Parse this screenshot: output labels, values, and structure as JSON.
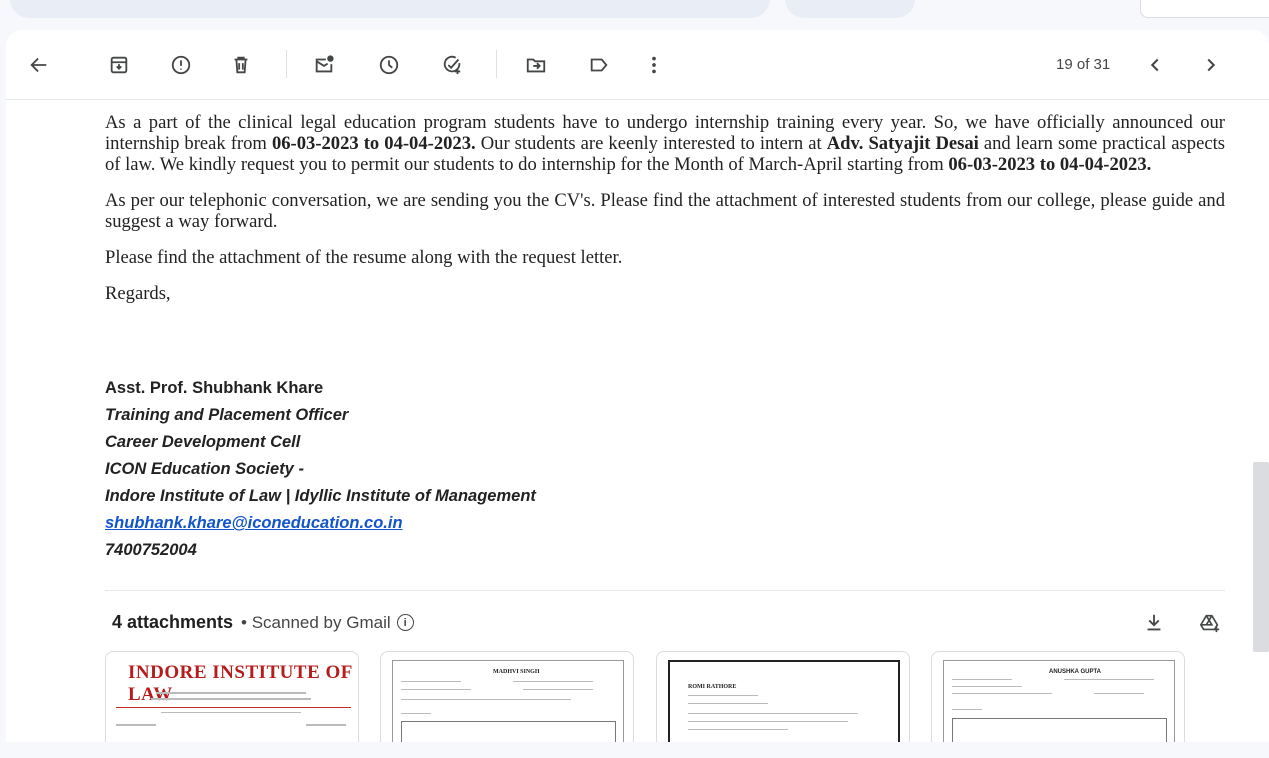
{
  "toolbar": {
    "back_icon": "arrow-left-icon",
    "archive_icon": "archive-icon",
    "report_spam_icon": "report-spam-icon",
    "delete_icon": "trash-icon",
    "mark_unread_icon": "mark-unread-icon",
    "snooze_icon": "clock-icon",
    "add_task_icon": "add-task-icon",
    "move_to_icon": "move-to-icon",
    "label_icon": "label-icon",
    "more_icon": "more-vert-icon",
    "counter": "19 of 31",
    "newer_icon": "chevron-left-icon",
    "older_icon": "chevron-right-icon"
  },
  "email": {
    "p1_a": "As a part of the clinical legal education program students have to undergo internship training every year. So, we have officially announced our internship break from ",
    "p1_b": "06-03-2023 to 04-04-2023.",
    "p1_c": " Our students are keenly interested to intern at ",
    "p1_d": "Adv. Satyajit Desai",
    "p1_e": " and learn some practical aspects of law. We kindly request you to permit our students to do internship for the Month of March-April starting from ",
    "p1_f": "06-03-2023 to 04-04-2023.",
    "p2": "As per our telephonic conversation, we are sending you the CV's. Please find the attachment of interested students from our college, please guide and suggest a way forward.",
    "p3": "Please find the attachment of the resume along with the request letter.",
    "p4": "Regards,"
  },
  "signature": {
    "name": "Asst. Prof. Shubhank Khare",
    "title": "Training and Placement Officer",
    "dept": "Career Development Cell",
    "org": "ICON Education Society -",
    "inst": "Indore Institute of Law | Idyllic Institute of Management",
    "email": "shubhank.khare@iconeducation.co.in",
    "phone": "7400752004"
  },
  "attachments": {
    "count_label": "4 attachments",
    "scanned": "• Scanned by Gmail",
    "download_all_icon": "download-icon",
    "save_to_drive_icon": "add-to-drive-icon",
    "items": [
      {
        "preview_title": "INDORE INSTITUTE OF LAW"
      },
      {
        "preview_title": "MADHVI SINGH"
      },
      {
        "preview_title": "ROMI RATHORE"
      },
      {
        "preview_title": "ANUSHKA GUPTA"
      }
    ]
  },
  "colors": {
    "accent_link": "#1155cc",
    "logo_red": "#b71c1c",
    "icon_gray": "#444746"
  }
}
